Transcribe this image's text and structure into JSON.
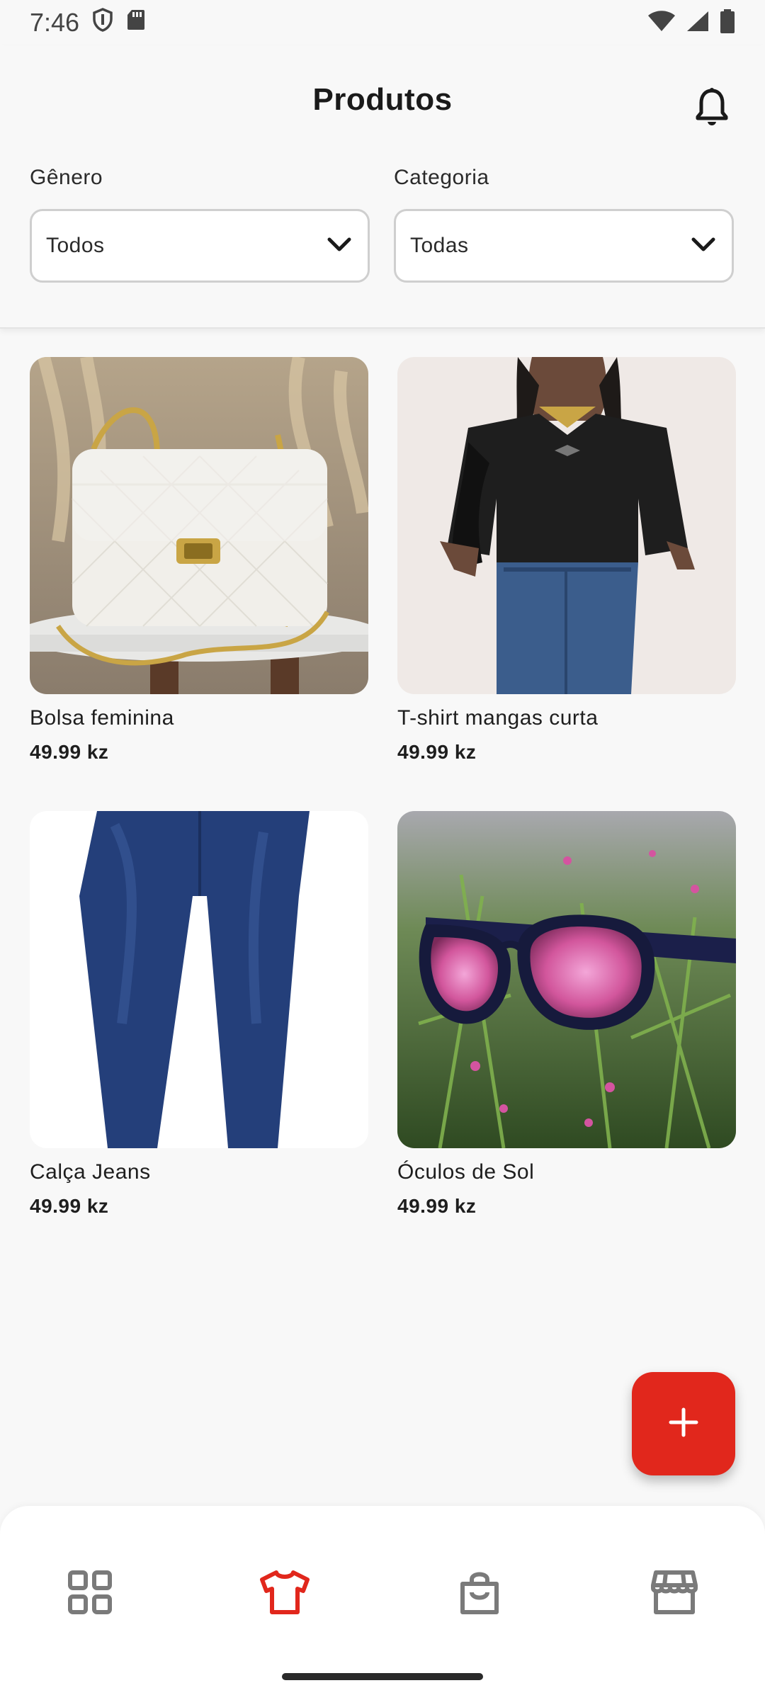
{
  "status_bar": {
    "time": "7:46"
  },
  "header": {
    "title": "Produtos",
    "filters": [
      {
        "label": "Gênero",
        "value": "Todos"
      },
      {
        "label": "Categoria",
        "value": "Todas"
      }
    ]
  },
  "products": [
    {
      "name": "Bolsa feminina",
      "price": "49.99 kz"
    },
    {
      "name": "T-shirt mangas curta",
      "price": "49.99 kz"
    },
    {
      "name": "Calça Jeans",
      "price": "49.99 kz"
    },
    {
      "name": "Óculos de Sol",
      "price": "49.99 kz"
    }
  ],
  "fab": {
    "icon": "plus-icon"
  },
  "bottom_nav": {
    "items": [
      {
        "icon": "grid-icon",
        "active": false
      },
      {
        "icon": "tshirt-icon",
        "active": true
      },
      {
        "icon": "shopping-bag-icon",
        "active": false
      },
      {
        "icon": "store-icon",
        "active": false
      }
    ]
  },
  "colors": {
    "accent": "#e1271c",
    "inactive_icon": "#7a7a7a",
    "background": "#f8f8f8"
  }
}
